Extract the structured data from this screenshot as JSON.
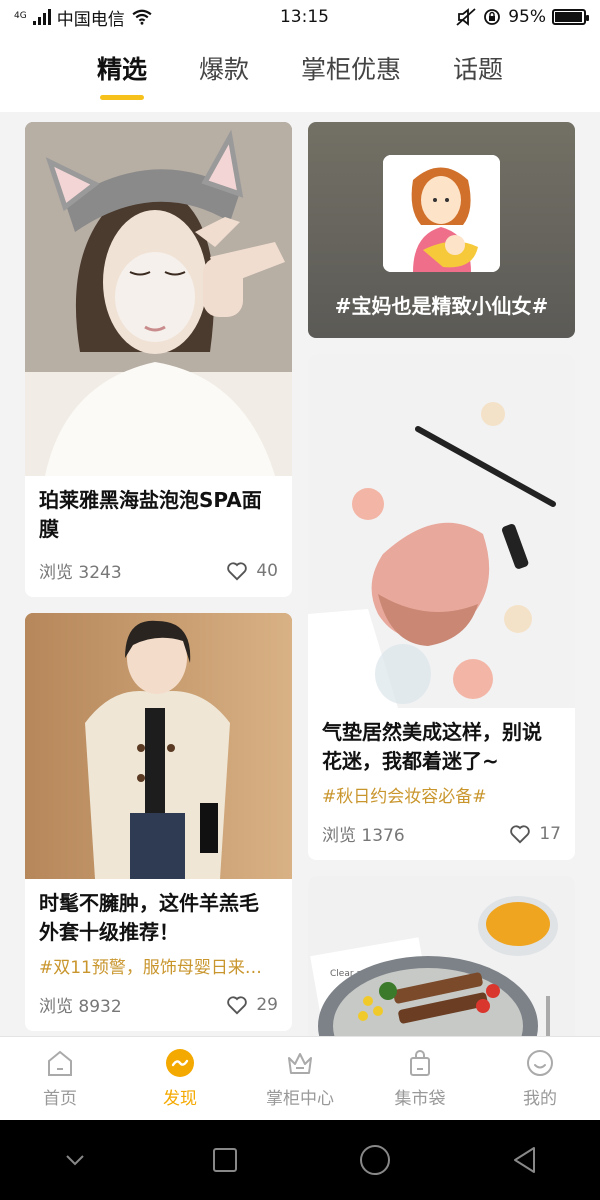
{
  "status": {
    "carrier": "中国电信",
    "network": "4G",
    "time": "13:15",
    "battery": "95%",
    "battery_level": 0.95
  },
  "tabs": [
    {
      "label": "精选",
      "active": true
    },
    {
      "label": "爆款",
      "active": false
    },
    {
      "label": "掌柜优惠",
      "active": false
    },
    {
      "label": "话题",
      "active": false
    }
  ],
  "feed": {
    "left": [
      {
        "title": "珀莱雅黑海盐泡泡SPA面膜",
        "topic": "",
        "views": "浏览 3243",
        "likes": "40"
      },
      {
        "title": "时髦不臃肿，这件羊羔毛外套十级推荐！",
        "topic": "#双11预警，服饰母婴日来…",
        "views": "浏览 8932",
        "likes": "29"
      }
    ],
    "right_topic": {
      "label": "#宝妈也是精致小仙女#"
    },
    "right": [
      {
        "title": "气垫居然美成这样，别说花迷，我都着迷了~",
        "topic": "#秋日约会妆容必备#",
        "views": "浏览 1376",
        "likes": "17"
      },
      {
        "photo_text": "Clear and simple"
      }
    ]
  },
  "bottom_nav": [
    {
      "label": "首页",
      "icon": "home-icon",
      "active": false
    },
    {
      "label": "发现",
      "icon": "discover-icon",
      "active": true
    },
    {
      "label": "掌柜中心",
      "icon": "crown-icon",
      "active": false
    },
    {
      "label": "集市袋",
      "icon": "bag-icon",
      "active": false
    },
    {
      "label": "我的",
      "icon": "smile-icon",
      "active": false
    }
  ],
  "colors": {
    "accent": "#f7c11b",
    "topic": "#c9962e",
    "nav_active": "#f4a900"
  }
}
